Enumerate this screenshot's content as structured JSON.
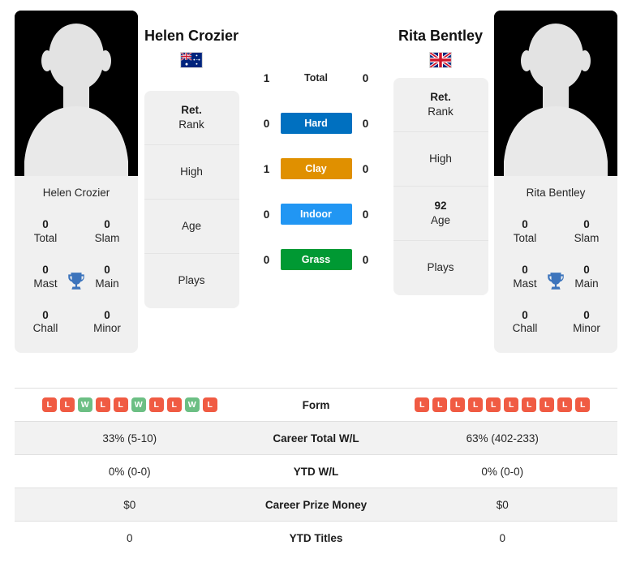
{
  "players": {
    "left": {
      "name": "Helen Crozier",
      "name_under_photo": "Helen Crozier",
      "country_flag_icon": "flag-australia-icon",
      "country": "Australia",
      "titles": [
        {
          "value": "0",
          "label": "Total"
        },
        {
          "value": "0",
          "label": "Slam"
        },
        {
          "value": "0",
          "label": "Mast"
        },
        {
          "value": "0",
          "label": "Main"
        },
        {
          "value": "0",
          "label": "Chall"
        },
        {
          "value": "0",
          "label": "Minor"
        }
      ],
      "info": [
        {
          "value": "Ret.",
          "label": "Rank"
        },
        {
          "value": "",
          "label": "High"
        },
        {
          "value": "",
          "label": "Age"
        },
        {
          "value": "",
          "label": "Plays"
        }
      ],
      "form": [
        "L",
        "L",
        "W",
        "L",
        "L",
        "W",
        "L",
        "L",
        "W",
        "L"
      ],
      "career_total_wl": "33% (5-10)",
      "ytd_wl": "0% (0-0)",
      "career_prize_money": "$0",
      "ytd_titles": "0"
    },
    "right": {
      "name": "Rita Bentley",
      "name_under_photo": "Rita Bentley",
      "country_flag_icon": "flag-united-kingdom-icon",
      "country": "United Kingdom",
      "titles": [
        {
          "value": "0",
          "label": "Total"
        },
        {
          "value": "0",
          "label": "Slam"
        },
        {
          "value": "0",
          "label": "Mast"
        },
        {
          "value": "0",
          "label": "Main"
        },
        {
          "value": "0",
          "label": "Chall"
        },
        {
          "value": "0",
          "label": "Minor"
        }
      ],
      "info": [
        {
          "value": "Ret.",
          "label": "Rank"
        },
        {
          "value": "",
          "label": "High"
        },
        {
          "value": "92",
          "label": "Age"
        },
        {
          "value": "",
          "label": "Plays"
        }
      ],
      "form": [
        "L",
        "L",
        "L",
        "L",
        "L",
        "L",
        "L",
        "L",
        "L",
        "L"
      ],
      "career_total_wl": "63% (402-233)",
      "ytd_wl": "0% (0-0)",
      "career_prize_money": "$0",
      "ytd_titles": "0"
    }
  },
  "head_to_head": {
    "rows": [
      {
        "label": "Total",
        "left": "1",
        "right": "0",
        "style": "plain",
        "color": ""
      },
      {
        "label": "Hard",
        "left": "0",
        "right": "0",
        "style": "badge",
        "color": "#0070C0"
      },
      {
        "label": "Clay",
        "left": "1",
        "right": "0",
        "style": "badge",
        "color": "#E09000"
      },
      {
        "label": "Indoor",
        "left": "0",
        "right": "0",
        "style": "badge",
        "color": "#2196F3"
      },
      {
        "label": "Grass",
        "left": "0",
        "right": "0",
        "style": "badge",
        "color": "#009933"
      }
    ]
  },
  "stats_table": {
    "rows": [
      {
        "label": "Form",
        "left": "",
        "right": "",
        "type": "form"
      },
      {
        "label": "Career Total W/L",
        "left": "33% (5-10)",
        "right": "63% (402-233)",
        "type": "text"
      },
      {
        "label": "YTD W/L",
        "left": "0% (0-0)",
        "right": "0% (0-0)",
        "type": "text"
      },
      {
        "label": "Career Prize Money",
        "left": "$0",
        "right": "$0",
        "type": "text"
      },
      {
        "label": "YTD Titles",
        "left": "0",
        "right": "0",
        "type": "text"
      }
    ]
  },
  "colors": {
    "win_badge": "#6CBF84",
    "loss_badge": "#F05B43",
    "card_bg": "#f0f0f0",
    "trophy": "#3C74BC",
    "row_alt": "#f2f2f2"
  }
}
